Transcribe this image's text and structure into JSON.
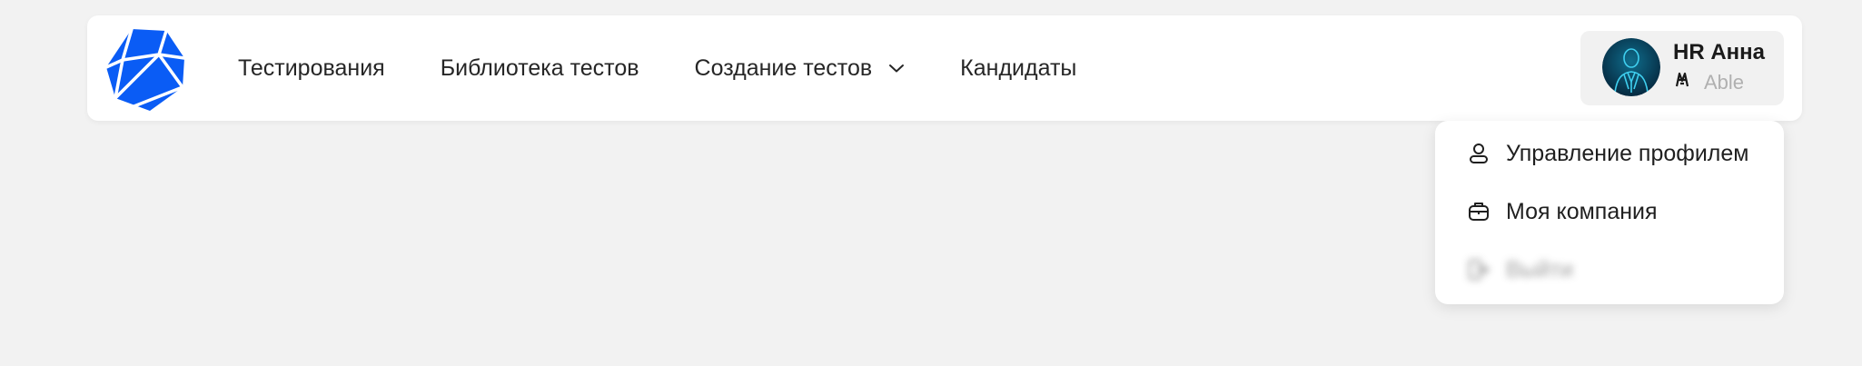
{
  "header": {
    "logo_icon": "crystal-logo-icon",
    "brand_color": "#0a5cf5",
    "nav": [
      {
        "label": "Тестирования"
      },
      {
        "label": "Библиотека тестов"
      },
      {
        "label": "Создание тестов",
        "has_dropdown": true
      },
      {
        "label": "Кандидаты"
      }
    ]
  },
  "profile": {
    "name": "HR Анна",
    "company": "Able",
    "avatar_icon": "businessman-avatar-icon",
    "company_icon": "able-logo-icon"
  },
  "dropdown": {
    "items": [
      {
        "label": "Управление профилем",
        "icon": "user-icon"
      },
      {
        "label": "Моя компания",
        "icon": "briefcase-icon"
      },
      {
        "label": "Выйти",
        "icon": "logout-icon"
      }
    ]
  }
}
